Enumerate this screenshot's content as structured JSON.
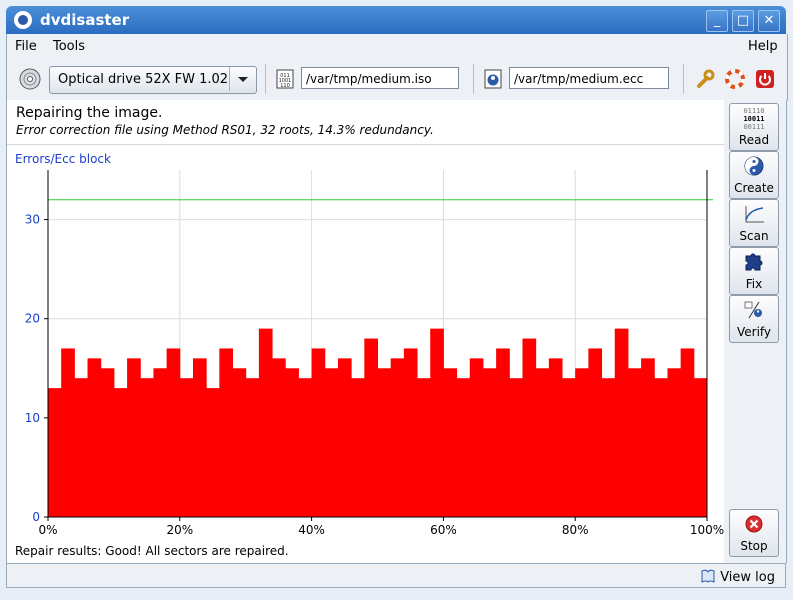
{
  "app": {
    "title": "dvdisaster"
  },
  "window_controls": {
    "minimize": "_",
    "maximize": "□",
    "close": "✕"
  },
  "menubar": {
    "file": "File",
    "tools": "Tools",
    "help": "Help"
  },
  "toolbar": {
    "drive": "Optical drive 52X FW 1.02",
    "image_file": "/var/tmp/medium.iso",
    "ecc_file": "/var/tmp/medium.ecc",
    "icons": [
      "disc-icon",
      "image-file-icon",
      "ecc-file-icon",
      "preferences-icon",
      "help-icon",
      "quit-icon"
    ]
  },
  "sidebar": {
    "read": "Read",
    "create": "Create",
    "scan": "Scan",
    "fix": "Fix",
    "verify": "Verify",
    "stop": "Stop",
    "read_icon_text": [
      "01110",
      "10011",
      "00111"
    ]
  },
  "main": {
    "heading": "Repairing the image.",
    "subheading": "Error correction file using Method RS01, 32 roots, 14.3% redundancy.",
    "result": "Repair results: Good! All sectors are repaired."
  },
  "status": {
    "view_log": "View log"
  },
  "colors": {
    "bars": "#ff0000",
    "threshold": "#33cc33",
    "axis_label": "#1a3fcf"
  },
  "chart_data": {
    "type": "bar",
    "ylabel": "Errors/Ecc block",
    "y_ticks": [
      "0",
      "10",
      "20",
      "30"
    ],
    "x_ticks": [
      "0%",
      "20%",
      "40%",
      "60%",
      "80%",
      "100%"
    ],
    "ylim": [
      0,
      35
    ],
    "threshold": 32,
    "grid": true,
    "x_percent": [
      0,
      2,
      4,
      6,
      8,
      10,
      12,
      14,
      16,
      18,
      20,
      22,
      24,
      26,
      28,
      30,
      32,
      34,
      36,
      38,
      40,
      42,
      44,
      46,
      48,
      50,
      52,
      54,
      56,
      58,
      60,
      62,
      64,
      66,
      68,
      70,
      72,
      74,
      76,
      78,
      80,
      82,
      84,
      86,
      88,
      90,
      92,
      94,
      96,
      98
    ],
    "values": [
      13,
      17,
      14,
      16,
      15,
      13,
      16,
      14,
      15,
      17,
      14,
      16,
      13,
      17,
      15,
      14,
      19,
      16,
      15,
      14,
      17,
      15,
      16,
      14,
      18,
      15,
      16,
      17,
      14,
      19,
      15,
      14,
      16,
      15,
      17,
      14,
      18,
      15,
      16,
      14,
      15,
      17,
      14,
      19,
      15,
      16,
      14,
      15,
      17,
      14
    ]
  }
}
